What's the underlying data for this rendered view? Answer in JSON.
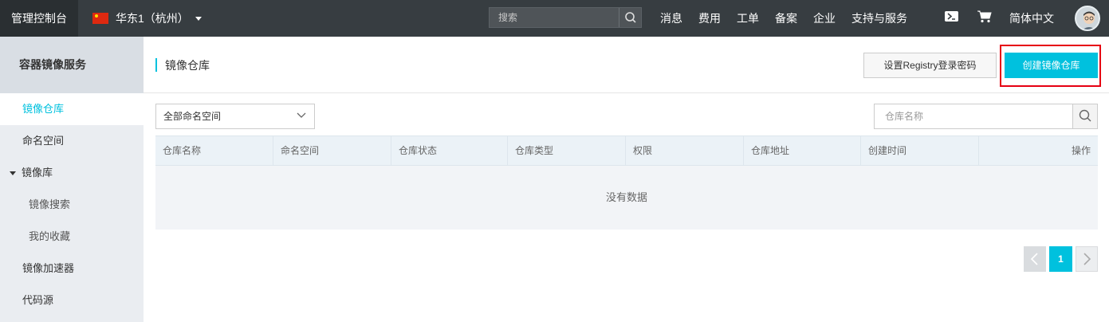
{
  "topbar": {
    "brand": "管理控制台",
    "region": "华东1（杭州）",
    "search_placeholder": "搜索",
    "nav": [
      "消息",
      "费用",
      "工单",
      "备案",
      "企业",
      "支持与服务"
    ],
    "language": "简体中文"
  },
  "sidebar": {
    "title": "容器镜像服务",
    "items": [
      {
        "label": "镜像仓库"
      },
      {
        "label": "命名空间"
      },
      {
        "label": "镜像库"
      },
      {
        "label": "镜像搜索"
      },
      {
        "label": "我的收藏"
      },
      {
        "label": "镜像加速器"
      },
      {
        "label": "代码源"
      }
    ]
  },
  "main": {
    "title": "镜像仓库",
    "btn_registry_password": "设置Registry登录密码",
    "btn_create_repo": "创建镜像仓库",
    "namespace_select": "全部命名空间",
    "repo_search_placeholder": "仓库名称",
    "columns": [
      "仓库名称",
      "命名空间",
      "仓库状态",
      "仓库类型",
      "权限",
      "仓库地址",
      "创建时间",
      "操作"
    ],
    "empty_text": "没有数据",
    "pagination": {
      "current": "1"
    }
  },
  "colors": {
    "accent": "#00c1de",
    "topbar": "#373d41",
    "highlight": "#e60012"
  }
}
